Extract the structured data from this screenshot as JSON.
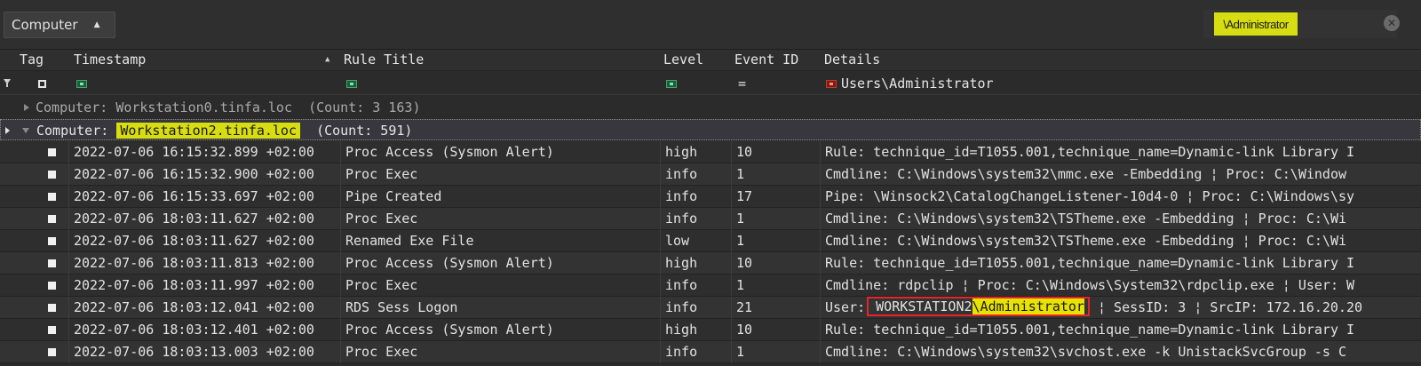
{
  "group_panel": {
    "chip_label": "Computer",
    "search_value": "\\Administrator"
  },
  "columns": {
    "tag": "Tag",
    "timestamp": "Timestamp",
    "rule_title": "Rule Title",
    "level": "Level",
    "event_id": "Event ID",
    "details": "Details"
  },
  "filters": {
    "details_value": "Users\\Administrator",
    "event_id_op": "="
  },
  "groups": [
    {
      "label": "Computer:",
      "value": "Workstation0.tinfa.loc",
      "count": "(Count: 3 163)"
    },
    {
      "label": "Computer:",
      "value": "Workstation2.tinfa.loc",
      "count": "(Count: 591)"
    }
  ],
  "rows": [
    {
      "timestamp": "2022-07-06 16:15:32.899 +02:00",
      "rule": "Proc Access (Sysmon Alert)",
      "level": "high",
      "event_id": "10",
      "details": "Rule: technique_id=T1055.001,technique_name=Dynamic-link Library I"
    },
    {
      "timestamp": "2022-07-06 16:15:32.900 +02:00",
      "rule": "Proc Exec",
      "level": "info",
      "event_id": "1",
      "details": "Cmdline: C:\\Windows\\system32\\mmc.exe -Embedding ¦ Proc: C:\\Window"
    },
    {
      "timestamp": "2022-07-06 16:15:33.697 +02:00",
      "rule": "Pipe Created",
      "level": "info",
      "event_id": "17",
      "details": "Pipe: \\Winsock2\\CatalogChangeListener-10d4-0 ¦ Proc: C:\\Windows\\sy"
    },
    {
      "timestamp": "2022-07-06 18:03:11.627 +02:00",
      "rule": "Proc Exec",
      "level": "info",
      "event_id": "1",
      "details": "Cmdline: C:\\Windows\\system32\\TSTheme.exe -Embedding ¦ Proc: C:\\Wi"
    },
    {
      "timestamp": "2022-07-06 18:03:11.627 +02:00",
      "rule": "Renamed Exe File",
      "level": "low",
      "event_id": "1",
      "details": "Cmdline: C:\\Windows\\system32\\TSTheme.exe -Embedding ¦ Proc: C:\\Wi"
    },
    {
      "timestamp": "2022-07-06 18:03:11.813 +02:00",
      "rule": "Proc Access (Sysmon Alert)",
      "level": "high",
      "event_id": "10",
      "details": "Rule: technique_id=T1055.001,technique_name=Dynamic-link Library I"
    },
    {
      "timestamp": "2022-07-06 18:03:11.997 +02:00",
      "rule": "Proc Exec",
      "level": "info",
      "event_id": "1",
      "details": "Cmdline: rdpclip ¦ Proc: C:\\Windows\\System32\\rdpclip.exe ¦ User: W"
    },
    {
      "timestamp": "2022-07-06 18:03:12.041 +02:00",
      "rule": "RDS Sess Logon",
      "level": "info",
      "event_id": "21",
      "details_prefix": "User:",
      "details_box_plain": "WORKSTATION2",
      "details_box_hl": "\\Administrator",
      "details_suffix": " ¦ SessID: 3 ¦ SrcIP: 172.16.20.20"
    },
    {
      "timestamp": "2022-07-06 18:03:12.401 +02:00",
      "rule": "Proc Access (Sysmon Alert)",
      "level": "high",
      "event_id": "10",
      "details": "Rule: technique_id=T1055.001,technique_name=Dynamic-link Library I"
    },
    {
      "timestamp": "2022-07-06 18:03:13.003 +02:00",
      "rule": "Proc Exec",
      "level": "info",
      "event_id": "1",
      "details": "Cmdline: C:\\Windows\\system32\\svchost.exe -k UnistackSvcGroup -s C"
    }
  ],
  "icons": {
    "filter_row": "funnel-icon",
    "sort": "sort-asc-icon",
    "clear": "clear-search-icon",
    "expand": "chevron-right-icon",
    "collapse": "chevron-down-icon"
  },
  "colors": {
    "search_highlight": "#d7dd10",
    "details_highlight": "#e8e200",
    "focus_box": "#e8232a"
  }
}
